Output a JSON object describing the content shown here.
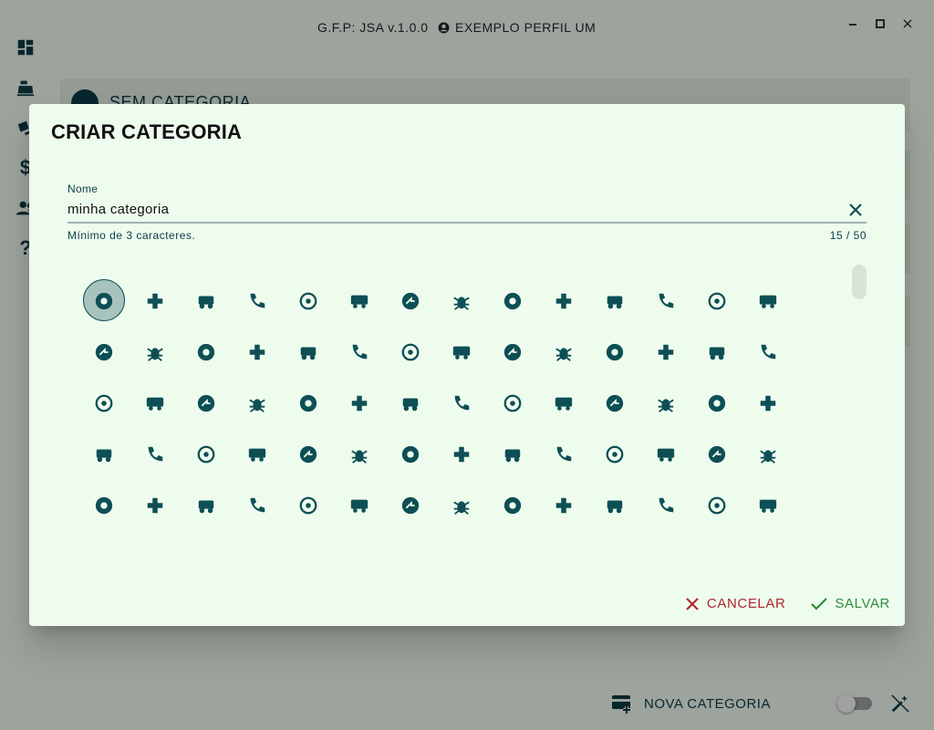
{
  "app": {
    "title": "G.F.P: JSA v.1.0.0",
    "profile_name": "EXEMPLO PERFIL UM",
    "background_card_title": "SEM CATEGORIA",
    "new_category_label": "NOVA CATEGORIA"
  },
  "sidebar": {
    "items": [
      {
        "icon": "dashboard-icon"
      },
      {
        "icon": "cash-register-icon"
      },
      {
        "icon": "cards-icon"
      },
      {
        "icon": "dollar-icon"
      },
      {
        "icon": "users-icon"
      },
      {
        "icon": "question-icon"
      }
    ]
  },
  "dialog": {
    "title": "CRIAR CATEGORIA",
    "field": {
      "label": "Nome",
      "value": "minha categoria",
      "hint": "Mínimo de 3 caracteres.",
      "counter": "15 / 50"
    },
    "icons": [
      "question-circle-icon",
      "plus-icon",
      "golf-cart-icon",
      "phone-incoming-icon",
      "crosshairs-icon",
      "van-icon",
      "share-circle-icon",
      "bug-icon",
      "tactic-icon",
      "wordpress-icon",
      "usb-icon",
      "person-icon",
      "account-circle-icon",
      "adobe-icon",
      "accessibility-icon",
      "hot-air-balloon-icon",
      "airplane-icon",
      "airplane-arrival-icon",
      "alarm-clock-icon",
      "album-icon",
      "alert-circle-icon",
      "alien-icon",
      "infinity-icon",
      "align-center-icon",
      "amazon-icon",
      "ambulance-icon",
      "anchor-icon",
      "android-icon",
      "antenna-icon",
      "apple-icon",
      "window-icon",
      "apps-grid-icon",
      "atom-icon",
      "ar-icon",
      "aws-icon",
      "bandage-icon",
      "stroller-icon",
      "baby-face-icon",
      "bacteria-icon",
      "balloon-icon",
      "bandage-cross-icon",
      "bank-icon",
      "baseball-icon",
      "basket-icon",
      "basketball-icon",
      "bat-icon",
      "battery-icon",
      "beach-icon",
      "beaker-icon",
      "bee-icon",
      "flower-bug-icon",
      "glass-icon",
      "bicycle-icon",
      "cyclist-icon",
      "binoculars-icon",
      "bio-icon",
      "biohazard-icon",
      "bitcoin-icon",
      "moon-circle-icon",
      "bluetooth-icon",
      "blur-icon",
      "bolt-icon",
      "bomb-icon",
      "dumbbell-icon",
      "book-icon",
      "bookmark-icon",
      "boombox-icon",
      "faucet-icon",
      "bottle-icon",
      "bottle-tonic-icon"
    ],
    "selected_index": 0,
    "cancel_label": "CANCELAR",
    "save_label": "SALVAR"
  },
  "colors": {
    "accent": "#0d4f55",
    "cancel": "#b3262b",
    "save": "#2e8b3a",
    "dialog_bg": "#eefcee"
  }
}
